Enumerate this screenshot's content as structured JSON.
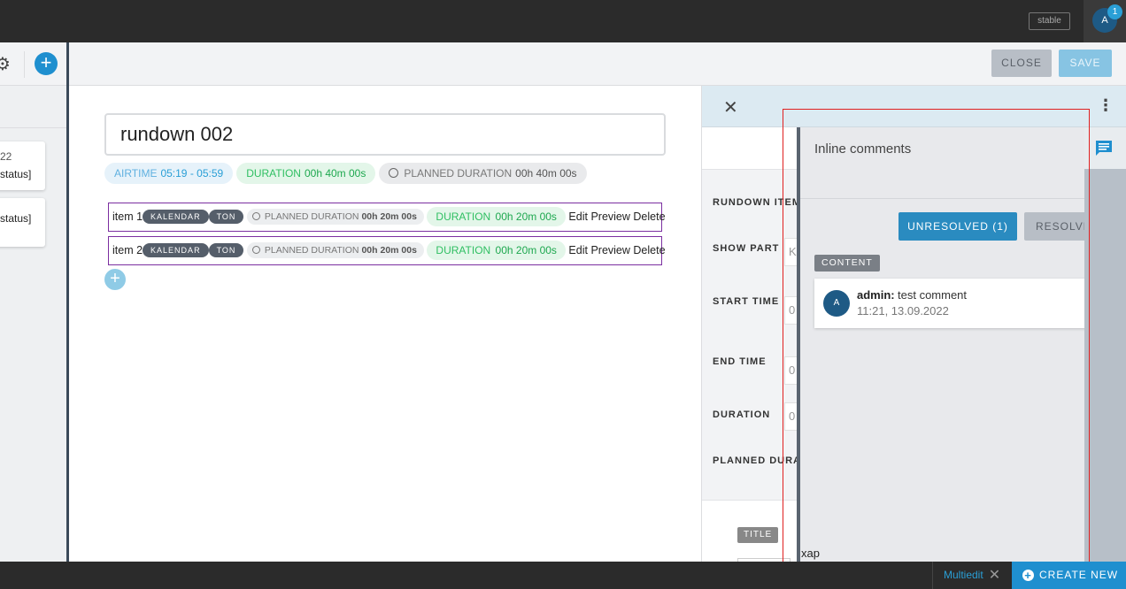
{
  "topbar": {
    "env_badge": "stable",
    "avatar_initial": "A",
    "notification_count": "1"
  },
  "sidebar": {
    "cards": [
      {
        "date": "22",
        "status": "status]"
      },
      {
        "date": "",
        "status": "status]"
      }
    ]
  },
  "actions": {
    "close_label": "CLOSE",
    "save_label": "SAVE"
  },
  "rundown": {
    "title": "rundown 002",
    "airtime_label": "AIRTIME",
    "airtime_value": "05:19 - 05:59",
    "duration_label": "DURATION",
    "duration_value": "00h 40m 00s",
    "planned_label": "PLANNED DURATION",
    "planned_value": "00h 40m 00s",
    "items": [
      {
        "name": "item 1",
        "tags": [
          "KALENDAR",
          "TON"
        ],
        "planned_label": "PLANNED DURATION",
        "planned_value": "00h 20m 00s",
        "duration_label": "DURATION",
        "duration_value": "00h 20m 00s",
        "edit": "Edit",
        "preview": "Preview",
        "delete": "Delete"
      },
      {
        "name": "item 2",
        "tags": [
          "KALENDAR",
          "TON"
        ],
        "planned_label": "PLANNED DURATION",
        "planned_value": "00h 20m 00s",
        "duration_label": "DURATION",
        "duration_value": "00h 20m 00s",
        "edit": "Edit",
        "preview": "Preview",
        "delete": "Delete"
      }
    ]
  },
  "item_panel": {
    "fields": [
      "RUNDOWN ITEM",
      "SHOW PART",
      "START TIME",
      "END TIME",
      "DURATION",
      "PLANNED DURAT"
    ],
    "show_part_stub": "K",
    "start_stub": "0",
    "end_stub": "0",
    "duration_stub": "0",
    "title_tag": "TITLE",
    "title_value": "xap"
  },
  "comments": {
    "heading": "Inline comments",
    "unresolved_label": "UNRESOLVED (1)",
    "resolved_label": "RESOLVE",
    "section_tag": "CONTENT",
    "list": [
      {
        "avatar": "A",
        "author": "admin:",
        "text": "test comment",
        "time": "11:21, 13.09.2022"
      }
    ]
  },
  "footer": {
    "multiedit_label": "Multiedit",
    "create_label": "CREATE NEW"
  },
  "colors": {
    "accent": "#1f8fcf",
    "highlight_box": "#e02020",
    "item_border": "#7b2fa0"
  }
}
